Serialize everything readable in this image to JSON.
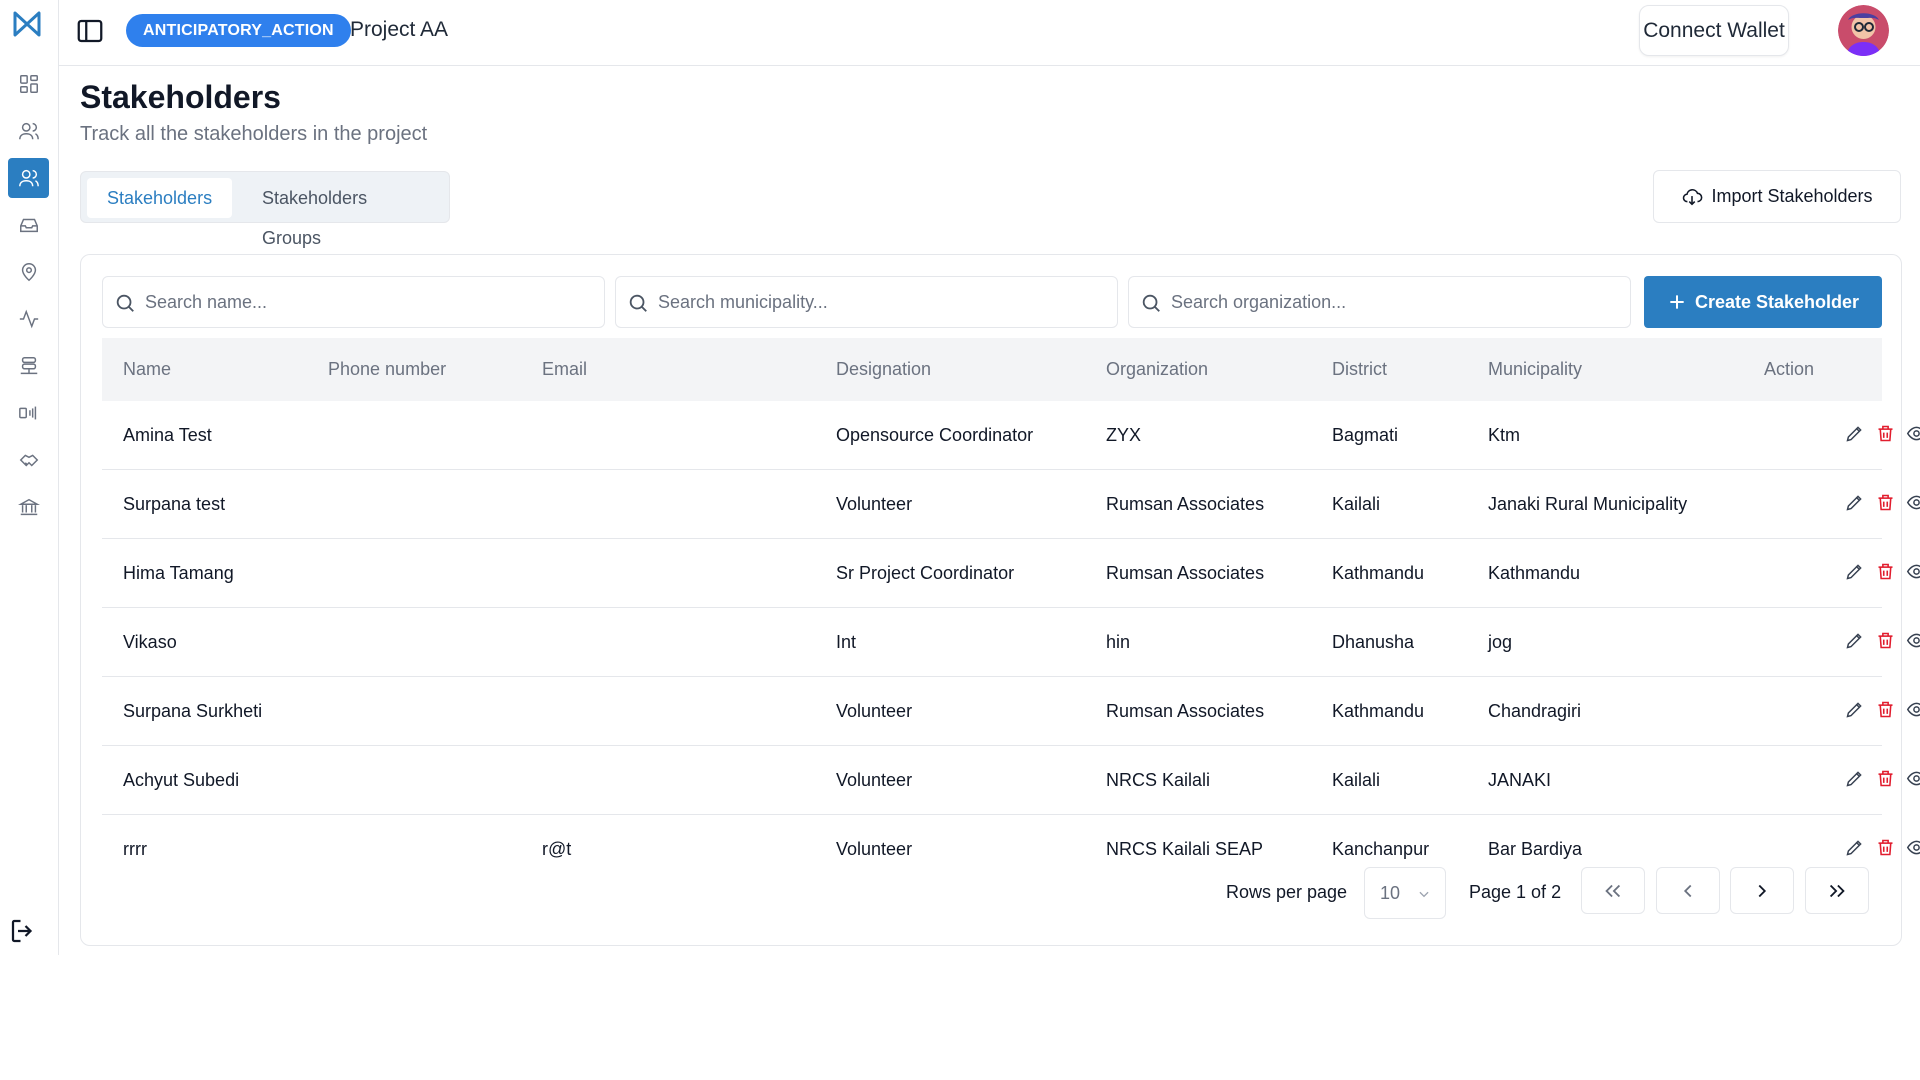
{
  "header": {
    "badge": "ANTICIPATORY_ACTION",
    "project": "Project AA",
    "wallet_label": "Connect Wallet"
  },
  "page": {
    "title": "Stakeholders",
    "subtitle": "Track all the stakeholders in the project"
  },
  "tabs": [
    {
      "label": "Stakeholders",
      "active": true
    },
    {
      "label": "Stakeholders Groups",
      "active": false
    }
  ],
  "import_label": "Import Stakeholders",
  "search": {
    "name_placeholder": "Search name...",
    "municipality_placeholder": "Search municipality...",
    "organization_placeholder": "Search organization..."
  },
  "create_label": "Create Stakeholder",
  "table": {
    "columns": [
      "Name",
      "Phone number",
      "Email",
      "Designation",
      "Organization",
      "District",
      "Municipality",
      "Action"
    ],
    "rows": [
      {
        "name": "Amina Test",
        "phone": "",
        "email": "",
        "designation": "Opensource Coordinator",
        "organization": "ZYX",
        "district": "Bagmati",
        "municipality": "Ktm"
      },
      {
        "name": "Surpana test",
        "phone": "",
        "email": "",
        "designation": "Volunteer",
        "organization": "Rumsan Associates",
        "district": "Kailali",
        "municipality": "Janaki Rural Municipality"
      },
      {
        "name": "Hima Tamang",
        "phone": "",
        "email": "",
        "designation": "Sr Project Coordinator",
        "organization": "Rumsan Associates",
        "district": "Kathmandu",
        "municipality": "Kathmandu"
      },
      {
        "name": "Vikaso",
        "phone": "",
        "email": "",
        "designation": "Int",
        "organization": "hin",
        "district": "Dhanusha",
        "municipality": "jog"
      },
      {
        "name": "Surpana Surkheti",
        "phone": "",
        "email": "",
        "designation": "Volunteer",
        "organization": "Rumsan Associates",
        "district": "Kathmandu",
        "municipality": "Chandragiri"
      },
      {
        "name": "Achyut Subedi",
        "phone": "",
        "email": "",
        "designation": "Volunteer",
        "organization": "NRCS Kailali",
        "district": "Kailali",
        "municipality": "JANAKI"
      },
      {
        "name": "rrrr",
        "phone": "",
        "email": "r@t",
        "designation": "Volunteer",
        "organization": "NRCS Kailali SEAP",
        "district": "Kanchanpur",
        "municipality": "Bar Bardiya"
      }
    ]
  },
  "pagination": {
    "rows_label": "Rows per page",
    "rows_value": "10",
    "page_label": "Page 1 of 2"
  },
  "colors": {
    "primary": "#2b7ec1",
    "badge": "#2f80ed",
    "delete": "#e11d2e"
  },
  "icons": {
    "sidebar": [
      "dashboard-icon",
      "users-icon",
      "stakeholders-icon",
      "inbox-icon",
      "location-icon",
      "activity-icon",
      "database-icon",
      "broadcast-icon",
      "handshake-icon",
      "bank-icon"
    ]
  }
}
